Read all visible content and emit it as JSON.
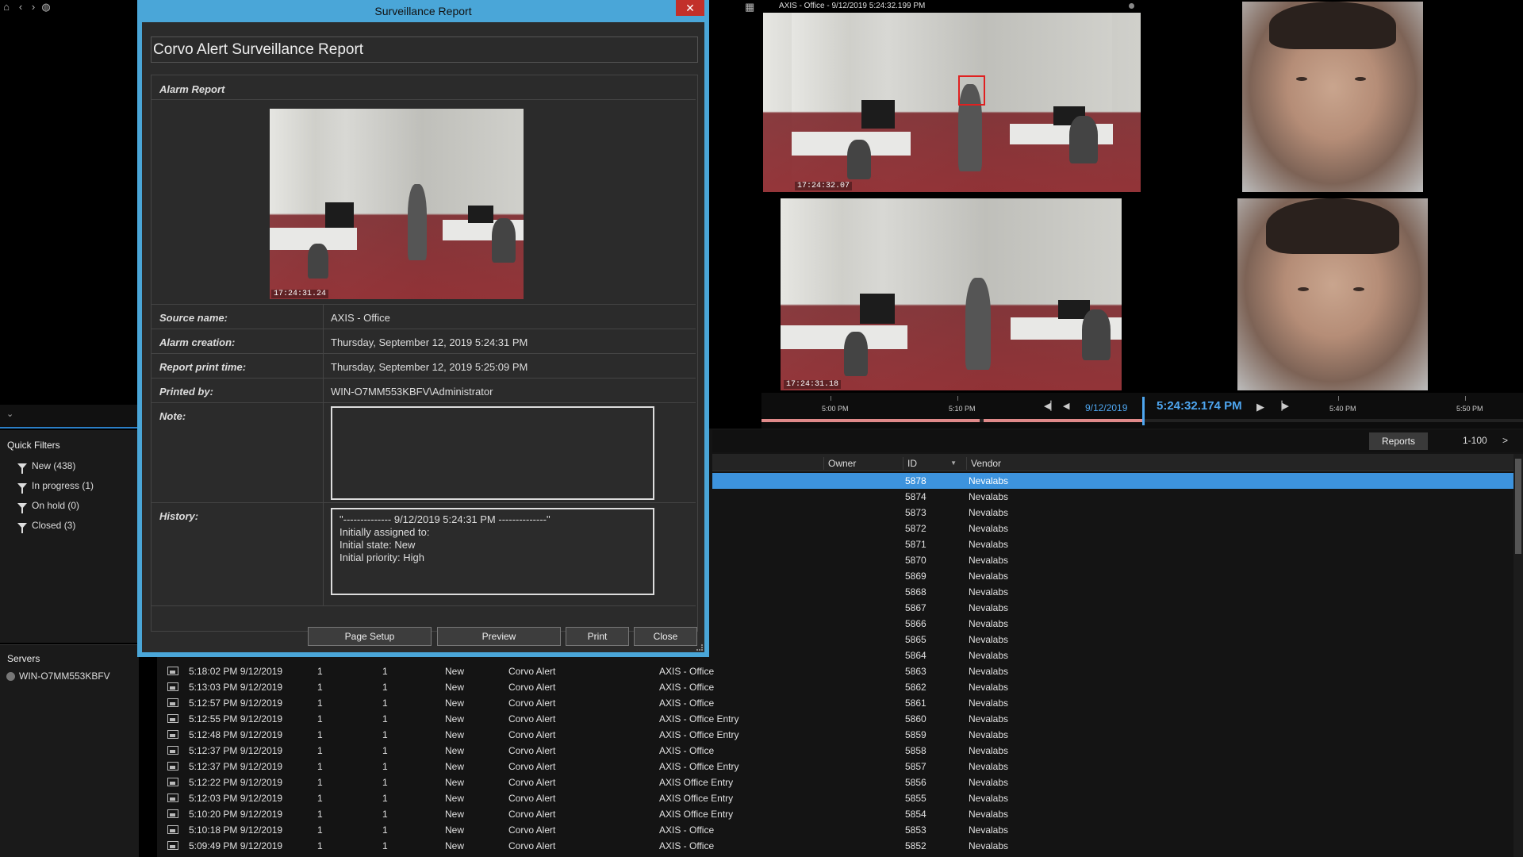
{
  "nav": {
    "home_icon": "home-icon",
    "back_icon": "chevron-left-icon",
    "forward_icon": "chevron-right-icon",
    "globe_icon": "globe-icon"
  },
  "quick_filters": {
    "title": "Quick Filters",
    "items": [
      {
        "label": "New (438)"
      },
      {
        "label": "In progress (1)"
      },
      {
        "label": "On hold (0)"
      },
      {
        "label": "Closed (3)"
      }
    ]
  },
  "servers": {
    "title": "Servers",
    "items": [
      {
        "label": "WIN-O7MM553KBFV"
      }
    ]
  },
  "toolbar": {
    "reports_label": "Reports",
    "range": "1-100",
    "next": ">"
  },
  "columns": {
    "owner": "Owner",
    "id": "ID",
    "vendor": "Vendor"
  },
  "rows_top": [
    {
      "id": "5878",
      "vendor": "Nevalabs",
      "selected": true
    },
    {
      "id": "5874",
      "vendor": "Nevalabs"
    },
    {
      "id": "5873",
      "vendor": "Nevalabs"
    },
    {
      "id": "5872",
      "vendor": "Nevalabs"
    },
    {
      "id": "5871",
      "vendor": "Nevalabs"
    },
    {
      "id": "5870",
      "vendor": "Nevalabs"
    },
    {
      "id": "5869",
      "vendor": "Nevalabs"
    },
    {
      "id": "5868",
      "vendor": "Nevalabs"
    },
    {
      "id": "5867",
      "vendor": "Nevalabs"
    },
    {
      "id": "5866",
      "vendor": "Nevalabs"
    },
    {
      "id": "5865",
      "vendor": "Nevalabs"
    },
    {
      "id": "5864",
      "vendor": "Nevalabs"
    }
  ],
  "rows_full": [
    {
      "time": "5:18:02 PM 9/12/2019",
      "c1": "1",
      "c2": "1",
      "state": "New",
      "type": "Corvo Alert",
      "source": "AXIS - Office",
      "id": "5863",
      "vendor": "Nevalabs"
    },
    {
      "time": "5:13:03 PM 9/12/2019",
      "c1": "1",
      "c2": "1",
      "state": "New",
      "type": "Corvo Alert",
      "source": "AXIS - Office",
      "id": "5862",
      "vendor": "Nevalabs"
    },
    {
      "time": "5:12:57 PM 9/12/2019",
      "c1": "1",
      "c2": "1",
      "state": "New",
      "type": "Corvo Alert",
      "source": "AXIS - Office",
      "id": "5861",
      "vendor": "Nevalabs"
    },
    {
      "time": "5:12:55 PM 9/12/2019",
      "c1": "1",
      "c2": "1",
      "state": "New",
      "type": "Corvo Alert",
      "source": "AXIS - Office Entry",
      "id": "5860",
      "vendor": "Nevalabs"
    },
    {
      "time": "5:12:48 PM 9/12/2019",
      "c1": "1",
      "c2": "1",
      "state": "New",
      "type": "Corvo Alert",
      "source": "AXIS - Office Entry",
      "id": "5859",
      "vendor": "Nevalabs"
    },
    {
      "time": "5:12:37 PM 9/12/2019",
      "c1": "1",
      "c2": "1",
      "state": "New",
      "type": "Corvo Alert",
      "source": "AXIS - Office",
      "id": "5858",
      "vendor": "Nevalabs"
    },
    {
      "time": "5:12:37 PM 9/12/2019",
      "c1": "1",
      "c2": "1",
      "state": "New",
      "type": "Corvo Alert",
      "source": "AXIS - Office Entry",
      "id": "5857",
      "vendor": "Nevalabs"
    },
    {
      "time": "5:12:22 PM 9/12/2019",
      "c1": "1",
      "c2": "1",
      "state": "New",
      "type": "Corvo Alert",
      "source": "AXIS Office Entry",
      "id": "5856",
      "vendor": "Nevalabs"
    },
    {
      "time": "5:12:03 PM 9/12/2019",
      "c1": "1",
      "c2": "1",
      "state": "New",
      "type": "Corvo Alert",
      "source": "AXIS Office Entry",
      "id": "5855",
      "vendor": "Nevalabs"
    },
    {
      "time": "5:10:20 PM 9/12/2019",
      "c1": "1",
      "c2": "1",
      "state": "New",
      "type": "Corvo Alert",
      "source": "AXIS Office Entry",
      "id": "5854",
      "vendor": "Nevalabs"
    },
    {
      "time": "5:10:18 PM 9/12/2019",
      "c1": "1",
      "c2": "1",
      "state": "New",
      "type": "Corvo Alert",
      "source": "AXIS - Office",
      "id": "5853",
      "vendor": "Nevalabs"
    },
    {
      "time": "5:09:49 PM 9/12/2019",
      "c1": "1",
      "c2": "1",
      "state": "New",
      "type": "Corvo Alert",
      "source": "AXIS - Office",
      "id": "5852",
      "vendor": "Nevalabs"
    }
  ],
  "cameras": {
    "cam1_title": "AXIS - Office - 9/12/2019 5:24:32.199 PM",
    "cam1_ts": "17:24:32.07",
    "cam2_ts": "17:24:31.18"
  },
  "timeline": {
    "ticks": [
      "5:00 PM",
      "5:10 PM",
      "5:40 PM",
      "5:50 PM"
    ],
    "date": "9/12/2019",
    "time": "5:24:32.174 PM"
  },
  "dialog": {
    "title": "Surveillance Report",
    "close_symbol": "✕",
    "report_title": "Corvo Alert Surveillance Report",
    "alarm_report_label": "Alarm Report",
    "image_ts": "17:24:31.24",
    "fields": {
      "source_name_label": "Source name:",
      "source_name": "AXIS - Office",
      "alarm_creation_label": "Alarm creation:",
      "alarm_creation": "Thursday, September 12, 2019 5:24:31 PM",
      "print_time_label": "Report print time:",
      "print_time": "Thursday, September 12, 2019 5:25:09 PM",
      "printed_by_label": "Printed by:",
      "printed_by": "WIN-O7MM553KBFV\\Administrator",
      "note_label": "Note:",
      "note_value": "",
      "history_label": "History:",
      "history_lines": [
        "\"--------------  9/12/2019 5:24:31 PM  --------------\"",
        "Initially assigned to:",
        "Initial state: New",
        "Initial priority: High"
      ]
    },
    "buttons": {
      "page_setup": "Page Setup",
      "preview": "Preview",
      "print": "Print",
      "close": "Close"
    }
  },
  "colors": {
    "accent": "#4aa6d8",
    "selected_row": "#3d93dd",
    "timeline_text": "#4ea6f0",
    "close_red": "#c2302a"
  }
}
